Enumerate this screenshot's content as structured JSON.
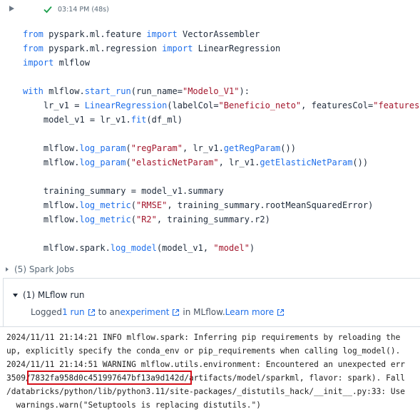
{
  "cell": {
    "exec_time": "03:14 PM (48s)"
  },
  "code_lines": [
    {
      "spans": [
        {
          "t": "from",
          "c": "kw"
        },
        {
          "t": " pyspark.ml.feature "
        },
        {
          "t": "import",
          "c": "kw"
        },
        {
          "t": " VectorAssembler"
        }
      ]
    },
    {
      "spans": [
        {
          "t": "from",
          "c": "kw"
        },
        {
          "t": " pyspark.ml.regression "
        },
        {
          "t": "import",
          "c": "kw"
        },
        {
          "t": " LinearRegression"
        }
      ]
    },
    {
      "spans": [
        {
          "t": "import",
          "c": "kw"
        },
        {
          "t": " mlflow"
        }
      ]
    },
    {
      "spans": []
    },
    {
      "spans": [
        {
          "t": "with",
          "c": "kw"
        },
        {
          "t": " mlflow."
        },
        {
          "t": "start_run",
          "c": "fn"
        },
        {
          "t": "(run_name="
        },
        {
          "t": "\"Modelo_V1\"",
          "c": "str"
        },
        {
          "t": "):"
        }
      ]
    },
    {
      "spans": [
        {
          "t": "    lr_v1 = "
        },
        {
          "t": "LinearRegression",
          "c": "fn"
        },
        {
          "t": "(labelCol="
        },
        {
          "t": "\"Beneficio_neto\"",
          "c": "str"
        },
        {
          "t": ", featuresCol="
        },
        {
          "t": "\"features\"",
          "c": "str"
        },
        {
          "t": ")"
        }
      ]
    },
    {
      "spans": [
        {
          "t": "    model_v1 = lr_v1."
        },
        {
          "t": "fit",
          "c": "fn"
        },
        {
          "t": "(df_ml)"
        }
      ]
    },
    {
      "spans": []
    },
    {
      "spans": [
        {
          "t": "    mlflow."
        },
        {
          "t": "log_param",
          "c": "fn"
        },
        {
          "t": "("
        },
        {
          "t": "\"regParam\"",
          "c": "str"
        },
        {
          "t": ", lr_v1."
        },
        {
          "t": "getRegParam",
          "c": "fn"
        },
        {
          "t": "())"
        }
      ]
    },
    {
      "spans": [
        {
          "t": "    mlflow."
        },
        {
          "t": "log_param",
          "c": "fn"
        },
        {
          "t": "("
        },
        {
          "t": "\"elasticNetParam\"",
          "c": "str"
        },
        {
          "t": ", lr_v1."
        },
        {
          "t": "getElasticNetParam",
          "c": "fn"
        },
        {
          "t": "())"
        }
      ]
    },
    {
      "spans": []
    },
    {
      "spans": [
        {
          "t": "    training_summary = model_v1.summary"
        }
      ]
    },
    {
      "spans": [
        {
          "t": "    mlflow."
        },
        {
          "t": "log_metric",
          "c": "fn"
        },
        {
          "t": "("
        },
        {
          "t": "\"RMSE\"",
          "c": "str"
        },
        {
          "t": ", training_summary.rootMeanSquaredError)"
        }
      ]
    },
    {
      "spans": [
        {
          "t": "    mlflow."
        },
        {
          "t": "log_metric",
          "c": "fn"
        },
        {
          "t": "("
        },
        {
          "t": "\"R2\"",
          "c": "str"
        },
        {
          "t": ", training_summary.r2)"
        }
      ]
    },
    {
      "spans": []
    },
    {
      "spans": [
        {
          "t": "    mlflow.spark."
        },
        {
          "t": "log_model",
          "c": "fn"
        },
        {
          "t": "(model_v1, "
        },
        {
          "t": "\"model\"",
          "c": "str"
        },
        {
          "t": ")"
        }
      ]
    }
  ],
  "spark_jobs": {
    "label": "(5) Spark Jobs"
  },
  "mlflow_run": {
    "title": "(1) MLflow run",
    "logged_prefix": "Logged ",
    "run_link": "1 run",
    "to_an": " to an ",
    "experiment_link": "experiment",
    "in_mlflow": " in MLflow. ",
    "learn_more_link": "Learn more"
  },
  "log_lines": [
    "2024/11/11 21:14:21 INFO mlflow.spark: Inferring pip requirements by reloading the",
    "up, explicitly specify the conda_env or pip_requirements when calling log_model().",
    "2024/11/11 21:14:51 WARNING mlflow.utils.environment: Encountered an unexpected err",
    "3509/7832fa958d0c451997647bf13a9d142d/artifacts/model/sparkml, flavor: spark). Fall",
    "/databricks/python/lib/python3.11/site-packages/_distutils_hack/__init__.py:33: Use",
    "  warnings.warn(\"Setuptools is replacing distutils.\")"
  ],
  "highlighted_run_id": "7832fa958d0c451997647bf13a9d142d",
  "colors": {
    "accent": "#1f6feb",
    "success": "#1a9e4a",
    "string": "#a3152b",
    "highlight": "#d6111b"
  }
}
